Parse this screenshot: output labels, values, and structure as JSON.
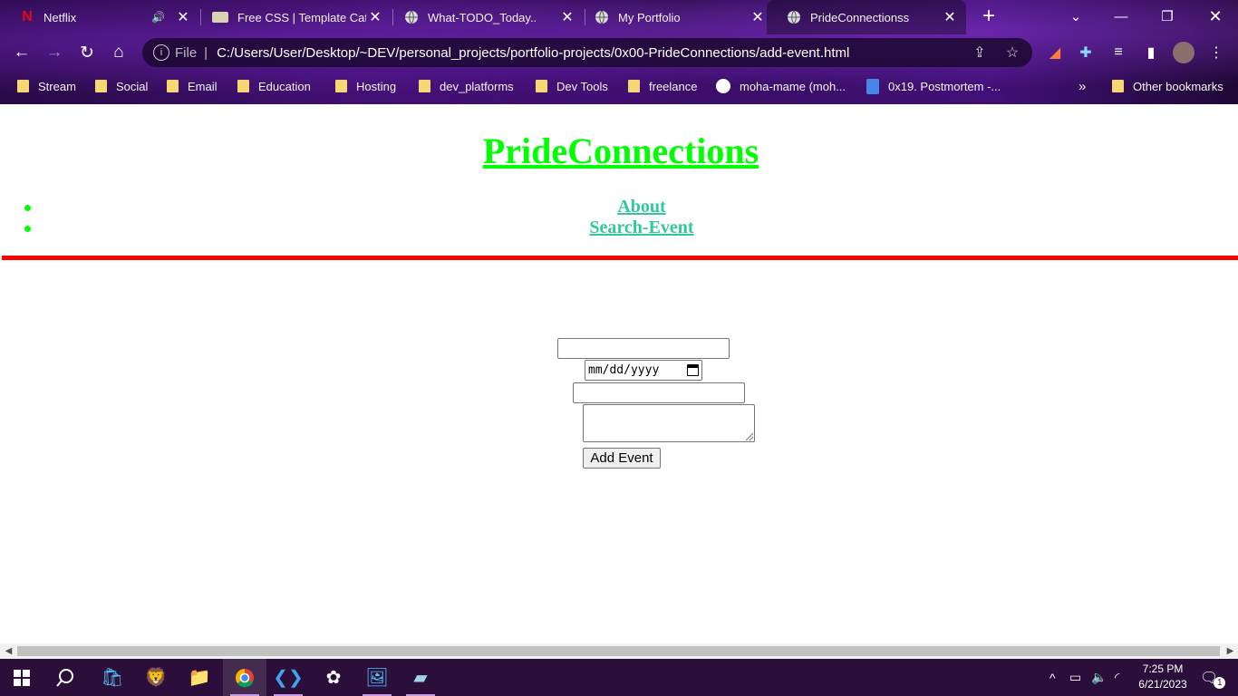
{
  "browser": {
    "tabs": [
      {
        "title": "Netflix",
        "icon": "netflix-icon",
        "audio": true
      },
      {
        "title": "Free CSS | Template Cat",
        "icon": "template-icon"
      },
      {
        "title": "What-TODO_Today..",
        "icon": "globe-icon"
      },
      {
        "title": "My Portfolio",
        "icon": "globe-icon"
      },
      {
        "title": "PrideConnectionss",
        "icon": "globe-icon",
        "active": true
      }
    ],
    "address": {
      "scheme_label": "File",
      "url": "C:/Users/User/Desktop/~DEV/personal_projects/portfolio-projects/0x00-PrideConnections/add-event.html"
    },
    "bookmarks": [
      {
        "label": "Stream",
        "icon": "folder-icon"
      },
      {
        "label": "Social",
        "icon": "folder-icon"
      },
      {
        "label": "Email",
        "icon": "folder-icon"
      },
      {
        "label": "Education",
        "icon": "folder-icon"
      },
      {
        "label": "Hosting",
        "icon": "folder-icon"
      },
      {
        "label": "dev_platforms",
        "icon": "folder-icon"
      },
      {
        "label": "Dev Tools",
        "icon": "folder-icon"
      },
      {
        "label": "freelance",
        "icon": "folder-icon"
      },
      {
        "label": "moha-mame (moh...",
        "icon": "github-icon"
      },
      {
        "label": "0x19. Postmortem -...",
        "icon": "docs-icon"
      }
    ],
    "bookmarks_overflow": "»",
    "other_bookmarks": "Other bookmarks"
  },
  "page": {
    "site_title": "PrideConnections",
    "nav": [
      {
        "label": "About"
      },
      {
        "label": "Search-Event"
      }
    ],
    "form": {
      "event_name": {
        "value": "",
        "placeholder": ""
      },
      "date": {
        "display": "mm/dd/yyyy"
      },
      "location": {
        "value": "",
        "placeholder": ""
      },
      "description": {
        "value": ""
      },
      "submit_label": "Add Event"
    }
  },
  "taskbar": {
    "time": "7:25 PM",
    "date": "6/21/2023",
    "notification_count": "1"
  },
  "colors": {
    "title_green": "#00ff00",
    "nav_link": "#2fc99a",
    "rule_red": "#ff0000",
    "taskbar": "#2b0f3a"
  }
}
